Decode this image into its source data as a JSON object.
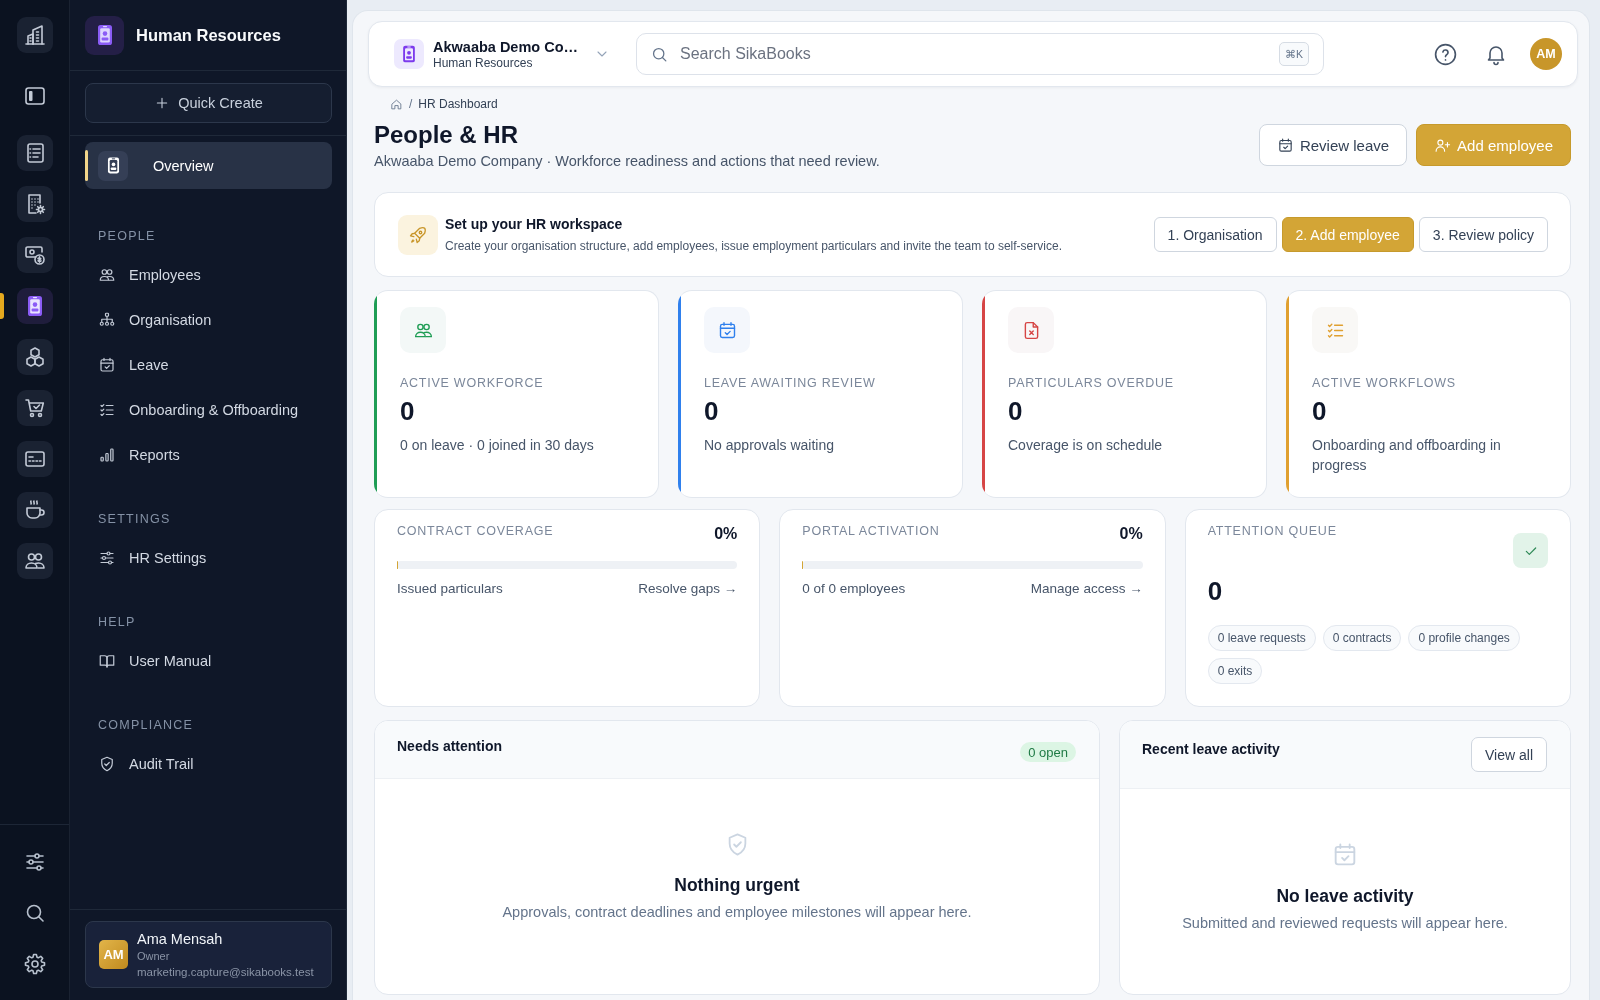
{
  "rail": {
    "items": [
      {
        "kind": "module",
        "selected": false
      },
      {
        "kind": "toggle",
        "selected": false
      },
      {
        "kind": "module",
        "selected": false
      },
      {
        "kind": "module",
        "selected": false
      },
      {
        "kind": "module",
        "selected": false
      },
      {
        "kind": "module",
        "selected": true
      },
      {
        "kind": "module",
        "selected": false
      },
      {
        "kind": "module",
        "selected": false
      },
      {
        "kind": "module",
        "selected": false
      },
      {
        "kind": "module",
        "selected": false
      },
      {
        "kind": "module",
        "selected": false
      }
    ]
  },
  "sidebar": {
    "title": "Human Resources",
    "quick_create": "Quick Create",
    "items": [
      {
        "label": "Overview",
        "selected": true
      }
    ],
    "sections": [
      {
        "heading": "PEOPLE",
        "items": [
          {
            "label": "Employees",
            "selected": false
          },
          {
            "label": "Organisation",
            "selected": false
          },
          {
            "label": "Leave",
            "selected": false
          },
          {
            "label": "Onboarding & Offboarding",
            "selected": false
          },
          {
            "label": "Reports",
            "selected": false
          }
        ]
      },
      {
        "heading": "SETTINGS",
        "items": [
          {
            "label": "HR Settings",
            "selected": false
          }
        ]
      },
      {
        "heading": "HELP",
        "items": [
          {
            "label": "User Manual",
            "selected": false
          }
        ]
      },
      {
        "heading": "COMPLIANCE",
        "items": [
          {
            "label": "Audit Trail",
            "selected": false
          }
        ]
      }
    ],
    "user": {
      "initials": "AM",
      "name": "Ama Mensah",
      "role": "Owner",
      "email": "marketing.capture@sikabooks.test"
    }
  },
  "topbar": {
    "company": "Akwaaba Demo Co…",
    "module": "Human Resources",
    "search": {
      "placeholder": "Search SikaBooks",
      "shortcut": "⌘K"
    },
    "avatar": "AM"
  },
  "breadcrumb": {
    "separator": "/",
    "current": "HR Dashboard"
  },
  "page": {
    "title": "People & HR",
    "subtitle": "Akwaaba Demo Company · Workforce readiness and actions that need review.",
    "actions": [
      {
        "label": "Review leave",
        "kind": "secondary"
      },
      {
        "label": "Add employee",
        "kind": "primary"
      }
    ]
  },
  "setup": {
    "title": "Set up your HR workspace",
    "description": "Create your organisation structure, add employees, issue employment particulars and invite the team to self-service.",
    "steps": [
      {
        "label": "1. Organisation",
        "selected": false
      },
      {
        "label": "2. Add employee",
        "selected": true
      },
      {
        "label": "3. Review policy",
        "selected": false
      }
    ]
  },
  "stats": [
    {
      "label": "ACTIVE WORKFORCE",
      "value": "0",
      "detail": "0 on leave · 0 joined in 30 days",
      "color": "#1f9d55"
    },
    {
      "label": "LEAVE AWAITING REVIEW",
      "value": "0",
      "detail": "No approvals waiting",
      "color": "#2f80ed"
    },
    {
      "label": "PARTICULARS OVERDUE",
      "value": "0",
      "detail": "Coverage is on schedule",
      "color": "#d64545"
    },
    {
      "label": "ACTIVE WORKFLOWS",
      "value": "0",
      "detail": "Onboarding and offboarding in progress",
      "color": "#e0a030"
    }
  ],
  "metrics": [
    {
      "kind": "progress",
      "label": "CONTRACT COVERAGE",
      "value": "0%",
      "level": 0,
      "caption": "Issued particulars",
      "link": "Resolve gaps →"
    },
    {
      "kind": "progress",
      "label": "PORTAL ACTIVATION",
      "value": "0%",
      "level": 0,
      "caption": "0 of 0 employees",
      "link": "Manage access →"
    },
    {
      "kind": "queue",
      "label": "ATTENTION QUEUE",
      "value": "0",
      "chips": [
        "0 leave requests",
        "0 contracts",
        "0 profile changes",
        "0 exits"
      ]
    }
  ],
  "needs_attention": {
    "title": "Needs attention",
    "badge": "0 open",
    "empty_title": "Nothing urgent",
    "empty_text": "Approvals, contract deadlines and employee milestones will appear here."
  },
  "recent_leave": {
    "title": "Recent leave activity",
    "action": "View all",
    "empty_title": "No leave activity",
    "empty_text": "Submitted and reviewed requests will appear here."
  }
}
